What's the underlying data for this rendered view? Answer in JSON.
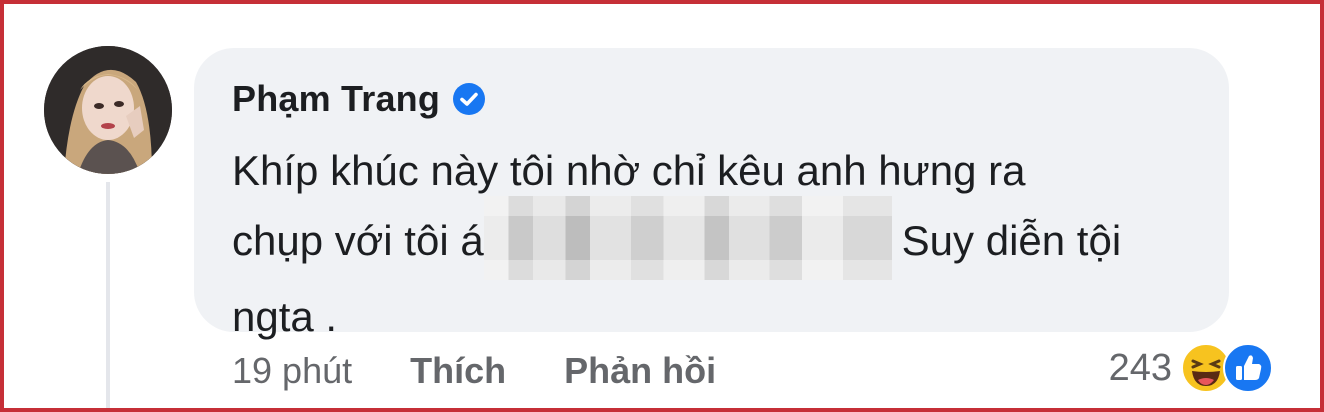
{
  "comment": {
    "author": "Phạm Trang",
    "verified_icon": "verified-badge-icon",
    "text_lines": [
      "Khíp khúc này tôi nhờ chỉ kêu anh hưng ra",
      "chụp với tôi á",
      "Suy diễn tội",
      "ngta ."
    ],
    "time": "19 phút",
    "like_label": "Thích",
    "reply_label": "Phản hồi",
    "reaction_count": "243",
    "reaction_icons": [
      "haha-icon",
      "like-icon"
    ]
  },
  "colors": {
    "frame_border": "#c62f37",
    "bubble_bg": "#f0f2f5",
    "verified_blue": "#1877f2",
    "secondary_text": "#65676b"
  }
}
